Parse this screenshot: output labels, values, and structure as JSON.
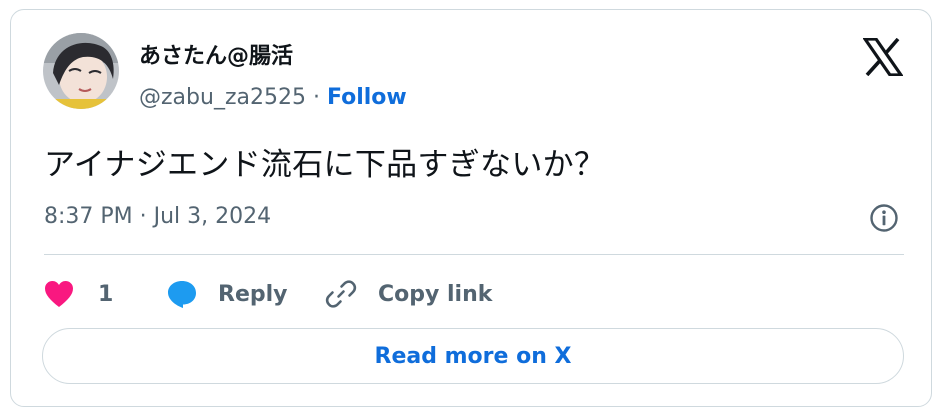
{
  "author": {
    "display_name": "あさたん@腸活",
    "handle": "@zabu_za2525",
    "separator": " · ",
    "follow_label": "Follow"
  },
  "tweet": {
    "text": "アイナジエンド流石に下品すぎないか？",
    "timestamp": "8:37 PM · Jul 3, 2024"
  },
  "actions": {
    "like_count": "1",
    "reply_label": "Reply",
    "copy_link_label": "Copy link"
  },
  "read_more_label": "Read more on X",
  "icons": {
    "brand": "x-logo-icon",
    "info": "info-icon",
    "like": "heart-icon",
    "reply": "speech-bubble-icon",
    "copy": "link-icon"
  },
  "colors": {
    "like": "#f91880",
    "reply": "#1d9bf0",
    "link": "#0f6ddb",
    "secondary_text": "#536471",
    "border": "#cfd9de"
  }
}
